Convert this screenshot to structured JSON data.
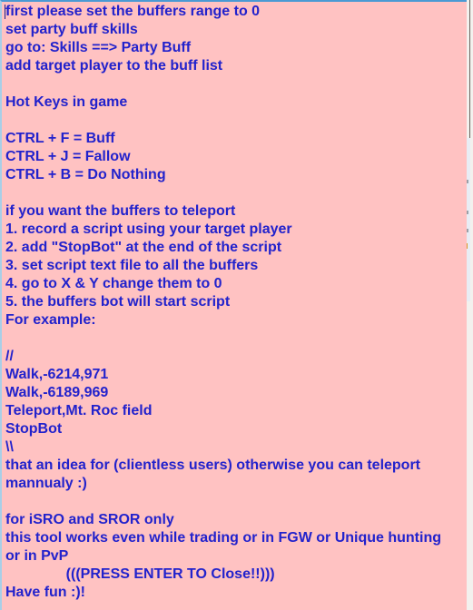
{
  "window": {
    "kind": "message-box",
    "panel_background": "#ffc2c2",
    "text_color": "#2222cc",
    "border_top_color": "#4a9ad4",
    "border_left_color": "#a8cfe8"
  },
  "message": {
    "lines": [
      "first please set the buffers range to 0",
      "set party buff skills",
      "go to: Skills ==> Party Buff",
      "add target player to the buff list",
      "",
      "Hot Keys in game",
      "",
      "CTRL + F = Buff",
      "CTRL + J = Fallow",
      "CTRL + B = Do Nothing",
      "",
      "if you want the buffers to teleport",
      "1. record a script using your target player",
      "2. add \"StopBot\" at the end of the script",
      "3. set script text file to all the buffers",
      "4. go to X & Y change them to 0",
      "5. the buffers bot will start script",
      "For example:",
      "",
      "//",
      "Walk,-6214,971",
      "Walk,-6189,969",
      "Teleport,Mt. Roc field",
      "StopBot",
      "\\\\",
      "that an idea for (clientless users) otherwise you can teleport",
      "mannualy :)",
      "",
      "for iSRO and SROR only",
      "this tool works even while trading or in FGW or Unique hunting",
      "or in PvP",
      "               (((PRESS ENTER TO Close!!)))",
      "Have fun :)!"
    ]
  },
  "hotkeys": [
    {
      "combo": "CTRL + F",
      "action": "Buff"
    },
    {
      "combo": "CTRL + J",
      "action": "Fallow"
    },
    {
      "combo": "CTRL + B",
      "action": "Do Nothing"
    }
  ],
  "teleport_steps": [
    "1. record a script using your target player",
    "2. add \"StopBot\" at the end of the script",
    "3. set script text file to all the buffers",
    "4. go to X & Y change them to 0",
    "5. the buffers bot will start script"
  ],
  "example_script": [
    "//",
    "Walk,-6214,971",
    "Walk,-6189,969",
    "Teleport,Mt. Roc field",
    "StopBot",
    "\\\\"
  ],
  "close_prompt": "(((PRESS ENTER TO Close!!)))",
  "sign_off": "Have fun :)!"
}
